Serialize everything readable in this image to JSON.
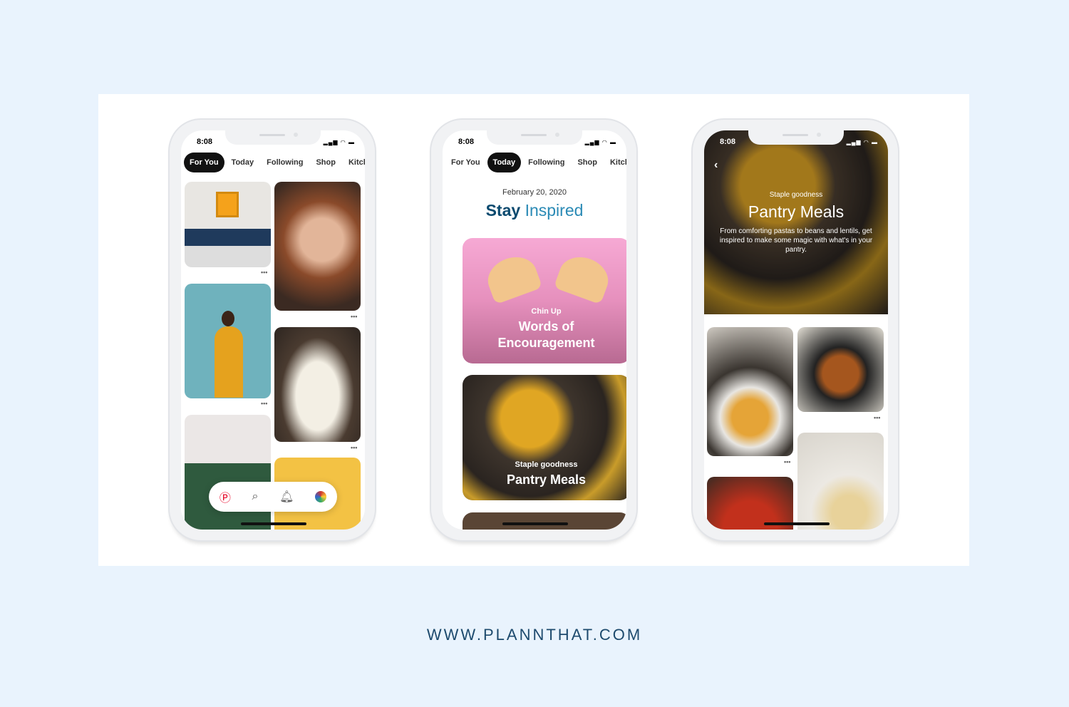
{
  "status": {
    "time": "8:08"
  },
  "tabs": [
    "For You",
    "Today",
    "Following",
    "Shop",
    "Kitcl"
  ],
  "phone1": {
    "active_tab": "For You",
    "nav": [
      "pinterest-home-icon",
      "search-icon",
      "bell-icon",
      "profile-avatar-icon"
    ]
  },
  "phone2": {
    "active_tab": "Today",
    "date": "February 20, 2020",
    "title_a": "Stay ",
    "title_b": "Inspired",
    "card1": {
      "kicker": "Chin Up",
      "title": "Words of Encouragement"
    },
    "card2": {
      "kicker": "Staple goodness",
      "title": "Pantry Meals"
    }
  },
  "phone3": {
    "kicker": "Staple goodness",
    "title": "Pantry Meals",
    "description": "From comforting pastas to beans and lentils, get inspired to make some magic with what's in your pantry."
  },
  "footer": "WWW.PLANNTHAT.COM",
  "colors": {
    "background": "#e9f3fd",
    "title": "#0b4a6f",
    "footer": "#1d4a6d",
    "pinterest": "#e60023"
  }
}
